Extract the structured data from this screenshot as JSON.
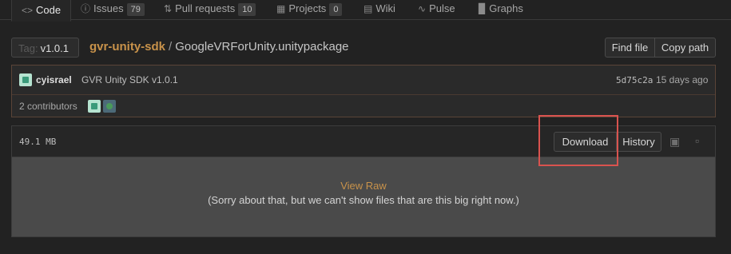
{
  "nav": {
    "code": "Code",
    "issues": "Issues",
    "issues_count": "79",
    "pull_requests": "Pull requests",
    "pull_requests_count": "10",
    "projects": "Projects",
    "projects_count": "0",
    "wiki": "Wiki",
    "pulse": "Pulse",
    "graphs": "Graphs"
  },
  "branch": {
    "prefix": "Tag:",
    "value": "v1.0.1"
  },
  "breadcrumb": {
    "repo": "gvr-unity-sdk",
    "separator": "/",
    "file": "GoogleVRForUnity.unitypackage"
  },
  "actions": {
    "find_file": "Find file",
    "copy_path": "Copy path"
  },
  "commit": {
    "author": "cyisrael",
    "message": "GVR Unity SDK v1.0.1",
    "sha": "5d75c2a",
    "time": "15 days ago"
  },
  "contributors": {
    "label": "2 contributors"
  },
  "file": {
    "size": "49.1 MB",
    "download": "Download",
    "history": "History",
    "view_raw": "View Raw",
    "too_big_message": "(Sorry about that, but we can't show files that are this big right now.)"
  },
  "colors": {
    "background": "#222222",
    "accent": "#c8924a",
    "highlight": "#d9534f"
  }
}
